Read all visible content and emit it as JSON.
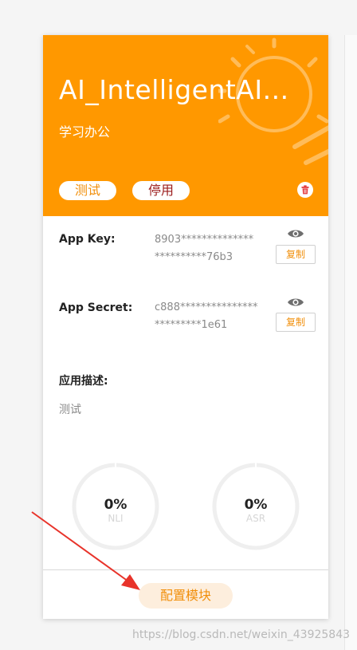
{
  "card": {
    "app_name": "AI_IntelligentAI...",
    "category": "学习办公",
    "test_button": "测试",
    "stop_button": "停用",
    "trash_icon": "trash-icon"
  },
  "credentials": {
    "app_key_label": "App Key:",
    "app_key_value": "8903************************76b3",
    "app_secret_label": "App Secret:",
    "app_secret_value": "c888************************1e61",
    "copy_label": "复制",
    "eye_icon": "eye-icon"
  },
  "description": {
    "title": "应用描述:",
    "text": "测试"
  },
  "stats": [
    {
      "value": "0%",
      "label": "NLI",
      "progress": 0
    },
    {
      "value": "0%",
      "label": "ASR",
      "progress": 0
    }
  ],
  "footer": {
    "config_button": "配置模块"
  },
  "watermark": "https://blog.csdn.net/weixin_43925843",
  "colors": {
    "accent": "#ff9800",
    "accent_text": "#f18f0b",
    "stop_text": "#9b1c1c",
    "annotation_arrow": "#e8332a"
  }
}
